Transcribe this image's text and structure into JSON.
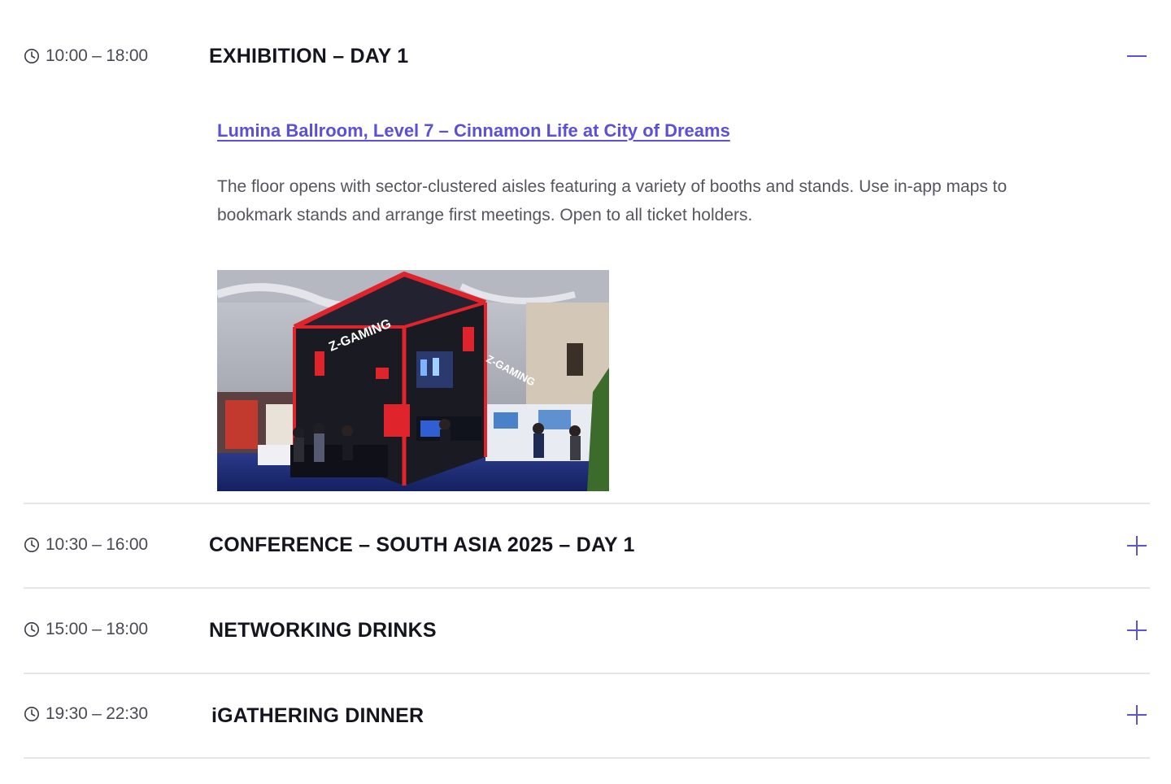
{
  "agenda": {
    "items": [
      {
        "time": "10:00 – 18:00",
        "title": "EXHIBITION – DAY 1",
        "expanded": true,
        "toggle_icon": "minus-icon",
        "venue_link": "Lumina Ballroom, Level 7 – Cinnamon Life at City of Dreams",
        "description": "The floor opens with sector-clustered aisles featuring a variety of booths and stands. Use in-app maps to bookmark stands and arrange first meetings. Open to all ticket holders.",
        "image": {
          "subject": "exhibition-booth-photo",
          "signage": "Z-GAMING"
        }
      },
      {
        "time": "10:30 – 16:00",
        "title": "CONFERENCE – SOUTH ASIA 2025 – DAY 1",
        "expanded": false,
        "toggle_icon": "plus-icon"
      },
      {
        "time": "15:00 – 18:00",
        "title": "NETWORKING DRINKS",
        "expanded": false,
        "toggle_icon": "plus-icon"
      },
      {
        "time": "19:30 – 22:30",
        "title": "iGATHERING DINNER",
        "expanded": false,
        "toggle_icon": "plus-icon"
      }
    ]
  },
  "colors": {
    "accent": "#5b55d6",
    "link": "#5b50d8",
    "title": "#15151f",
    "body_text": "#55555f",
    "divider": "#e6e6ea",
    "booth_red": "#e0242c"
  },
  "icons": {
    "time": "clock-icon"
  }
}
